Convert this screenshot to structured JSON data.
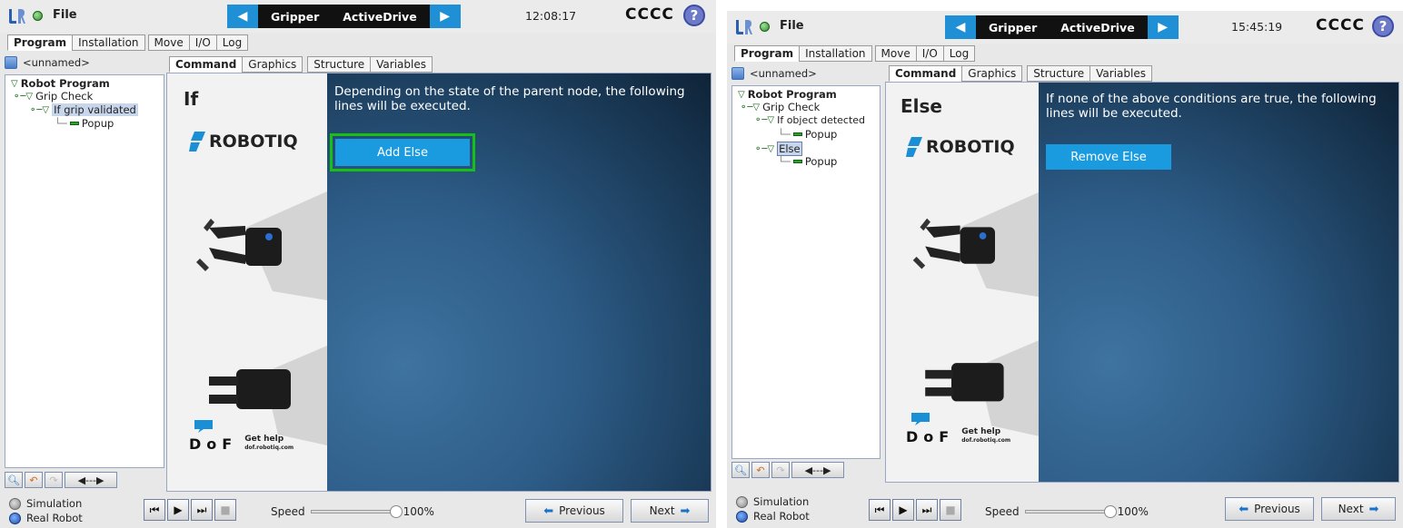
{
  "panels": [
    {
      "file_label": "File",
      "nav_left_icon": "left-arrow-icon",
      "nav_items": [
        "Gripper",
        "ActiveDrive"
      ],
      "nav_right_icon": "right-arrow-icon",
      "clock": "12:08:17",
      "robot_name": "CCCC",
      "help": "?",
      "main_tabs": [
        "Program",
        "Installation",
        "Move",
        "I/O",
        "Log"
      ],
      "program_name": "<unnamed>",
      "content_tabs": [
        "Command",
        "Graphics",
        "Structure",
        "Variables"
      ],
      "tree": {
        "root": "Robot Program",
        "grip_check": "Grip Check",
        "node_a": "If grip validated",
        "node_a_child": "Popup"
      },
      "node_title": "If",
      "brand": "ROBOTIQ",
      "description": "Depending on the state of the parent node, the following lines will be executed.",
      "action_button": "Add Else",
      "dof_letters": "DoF",
      "dof_help_title": "Get help",
      "dof_help_url": "dof.robotiq.com",
      "simulation": "Simulation",
      "real_robot": "Real Robot",
      "speed_label": "Speed",
      "speed_value": "100%",
      "previous": "Previous",
      "next": "Next"
    },
    {
      "file_label": "File",
      "nav_left_icon": "left-arrow-icon",
      "nav_items": [
        "Gripper",
        "ActiveDrive"
      ],
      "nav_right_icon": "right-arrow-icon",
      "clock": "15:45:19",
      "robot_name": "CCCC",
      "help": "?",
      "main_tabs": [
        "Program",
        "Installation",
        "Move",
        "I/O",
        "Log"
      ],
      "program_name": "<unnamed>",
      "content_tabs": [
        "Command",
        "Graphics",
        "Structure",
        "Variables"
      ],
      "tree": {
        "root": "Robot Program",
        "grip_check": "Grip Check",
        "node_a": "If object detected",
        "node_a_child": "Popup",
        "node_b": "Else",
        "node_b_child": "Popup"
      },
      "node_title": "Else",
      "brand": "ROBOTIQ",
      "description": "If none of the above conditions are true, the following lines will be executed.",
      "action_button": "Remove Else",
      "dof_letters": "DoF",
      "dof_help_title": "Get help",
      "dof_help_url": "dof.robotiq.com",
      "simulation": "Simulation",
      "real_robot": "Real Robot",
      "speed_label": "Speed",
      "speed_value": "100%",
      "previous": "Previous",
      "next": "Next"
    }
  ],
  "colors": {
    "accent_blue": "#1a9be0",
    "highlight_green": "#16c016",
    "nav_black": "#111111"
  }
}
